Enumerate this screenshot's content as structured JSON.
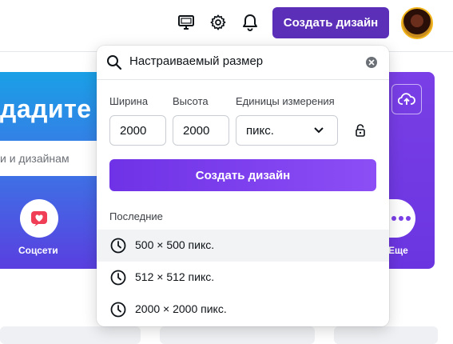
{
  "topbar": {
    "create_button": "Создать дизайн"
  },
  "hero": {
    "title_fragment": "дадите",
    "search_placeholder_fragment": "и и дизайнам",
    "categories": [
      {
        "label": "Соцсети",
        "icon": "heart-icon"
      },
      {
        "label": "Еще",
        "icon": "more-icon"
      }
    ]
  },
  "popup": {
    "search_value": "Настраиваемый размер",
    "width_label": "Ширина",
    "height_label": "Высота",
    "units_label": "Единицы измерения",
    "width_value": "2000",
    "height_value": "2000",
    "units_value": "пикс.",
    "create_button": "Создать дизайн",
    "recent_label": "Последние",
    "recent_items": [
      {
        "text": "500 × 500 пикс."
      },
      {
        "text": "512 × 512 пикс."
      },
      {
        "text": "2000 × 2000 пикс."
      }
    ]
  },
  "colors": {
    "brand_purple": "#5b2fb8",
    "button_gradient_start": "#6f32e6",
    "button_gradient_end": "#8c4ef5"
  }
}
